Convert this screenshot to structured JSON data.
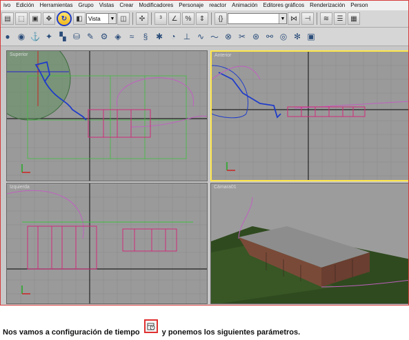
{
  "menu": [
    "ivo",
    "Edición",
    "Herramientas",
    "Grupo",
    "Vistas",
    "Crear",
    "Modificadores",
    "Personaje",
    "reactor",
    "Animación",
    "Editores gráficos",
    "Renderización",
    "Person"
  ],
  "toolbar": {
    "view_combo": "Vista",
    "selection_set_combo": ""
  },
  "viewports": {
    "top_label": "Superior",
    "front_label": "Anterior",
    "left_label": "Izquierda",
    "camera_label": "Cámara01"
  },
  "caption": {
    "before": "Nos vamos a configuración de tiempo",
    "after": "y ponemos los siguientes parámetros."
  },
  "colors": {
    "active_viewport": "#ffe74a",
    "highlight": "#1f3cc9",
    "frame": "#d63a3a"
  },
  "icons": [
    "select-icon",
    "region-select-icon",
    "move-icon",
    "rotate-icon",
    "scale-icon",
    "snap-icon",
    "angle-snap-icon",
    "percent-snap-icon",
    "mirror-icon",
    "align-icon",
    "layers-icon",
    "curve-editor-icon",
    "schematic-icon",
    "render-icon",
    "time-config-icon"
  ]
}
